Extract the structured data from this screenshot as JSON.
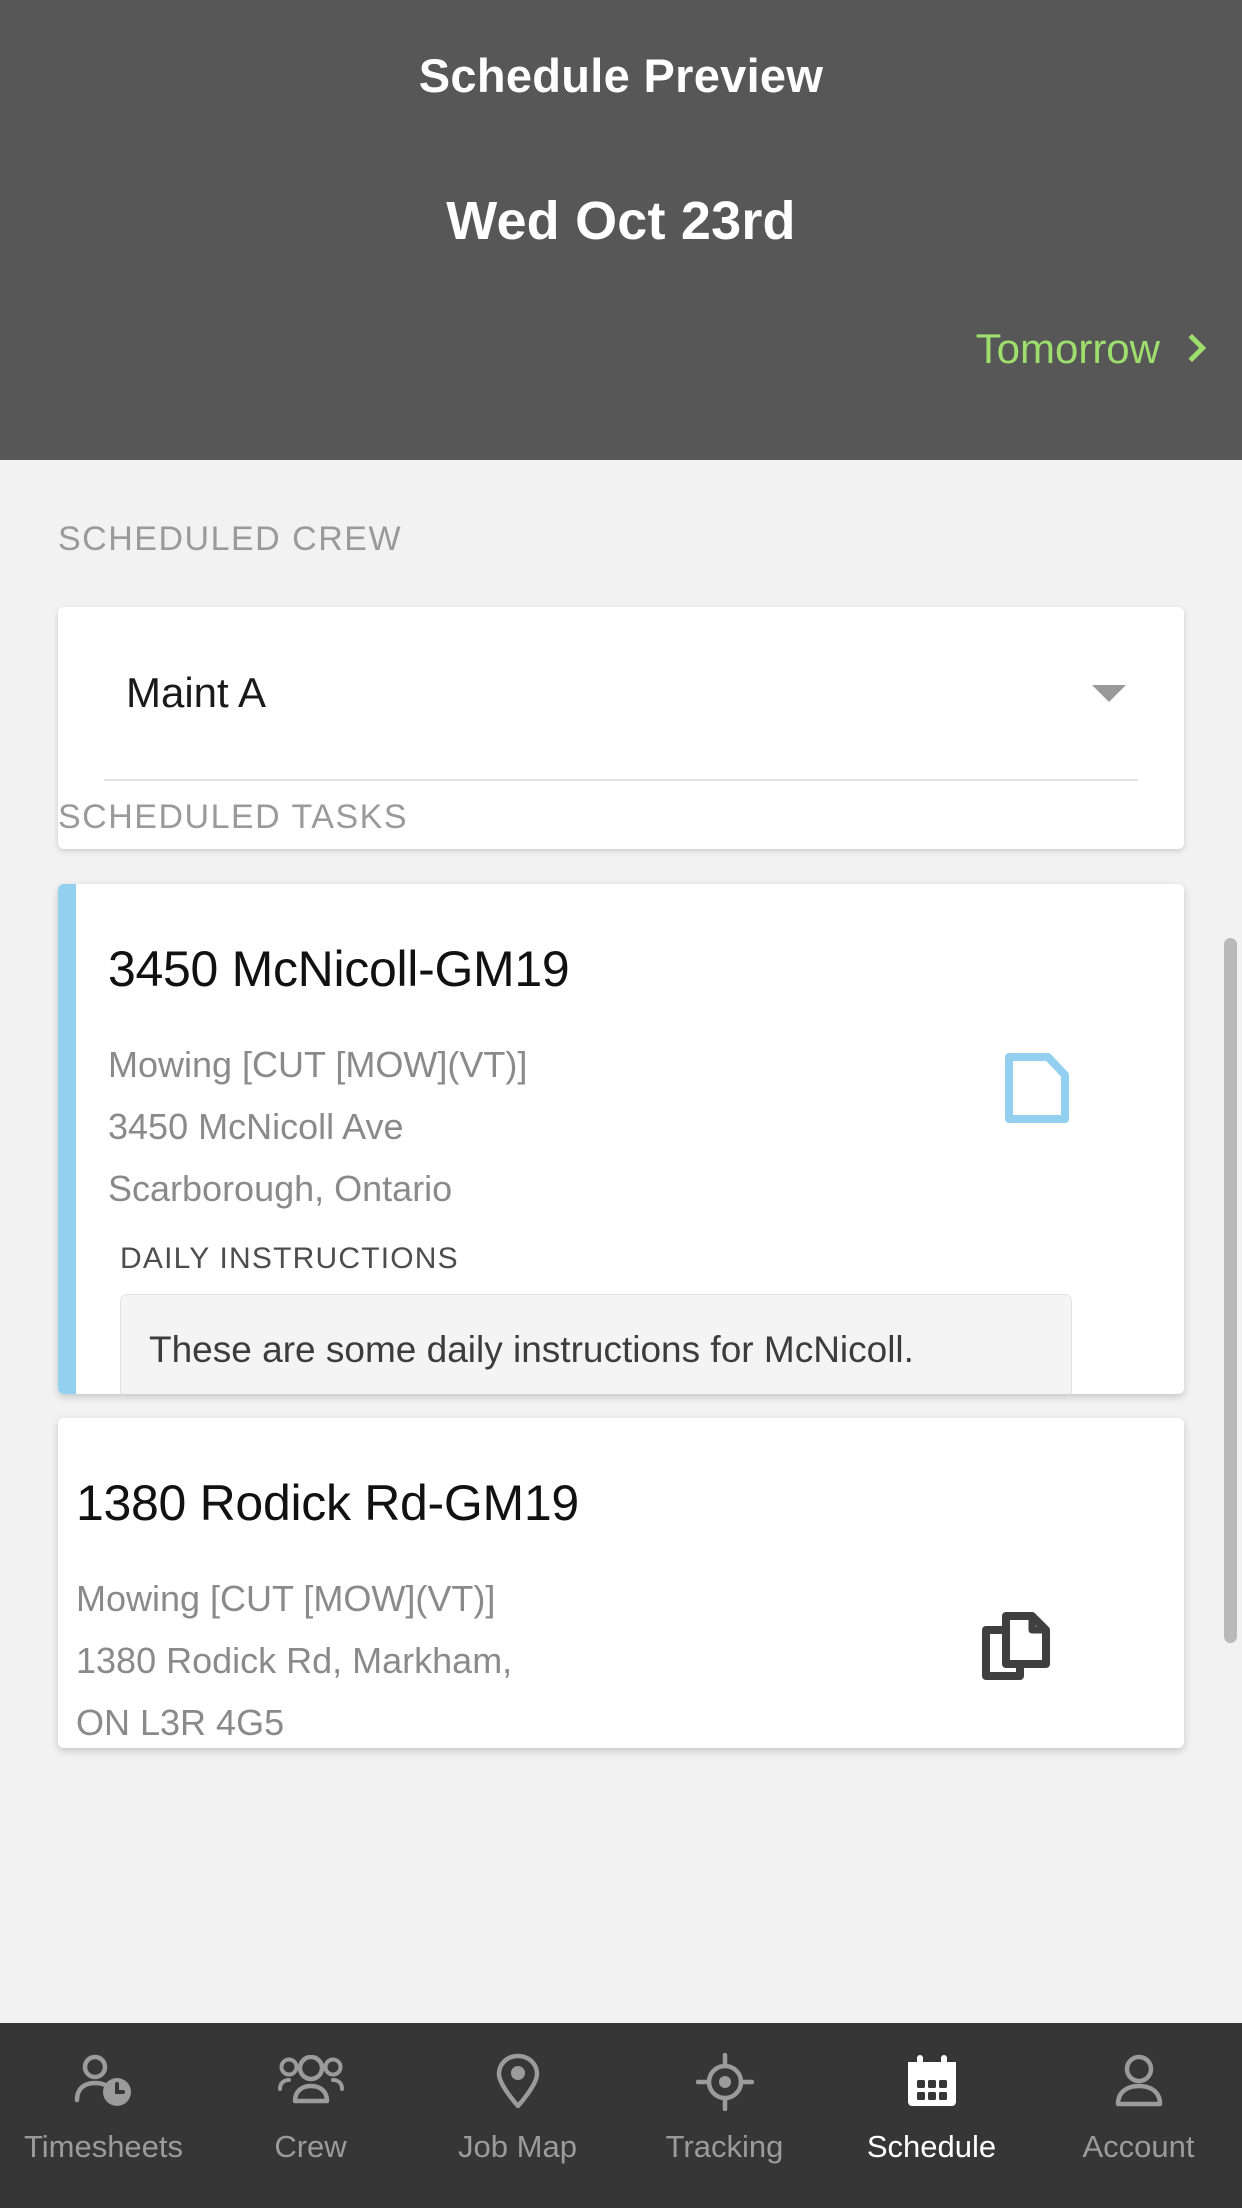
{
  "header": {
    "title": "Schedule Preview",
    "date": "Wed Oct 23rd",
    "next_label": "Tomorrow",
    "next_icon": "chevron-right-icon",
    "background_color": "#575757",
    "accent_color": "#9ede6c"
  },
  "crew_section": {
    "label": "SCHEDULED CREW",
    "selected_crew": "Maint A",
    "dropdown_icon": "caret-down-icon"
  },
  "tasks_section": {
    "label": "SCHEDULED TASKS",
    "accent_color": "#93d0f0",
    "items": [
      {
        "title": "3450 McNicoll-GM19",
        "service": "Mowing [CUT [MOW](VT)]",
        "address_line1": "3450 McNicoll Ave",
        "address_line2": "Scarborough, Ontario",
        "icon": "note-document-icon",
        "icon_color": "#93d0f0",
        "instructions_label": "DAILY INSTRUCTIONS",
        "instructions_text": "These are some daily instructions for McNicoll."
      },
      {
        "title": "1380 Rodick Rd-GM19",
        "service": "Mowing [CUT [MOW](VT)]",
        "address_line1": "1380 Rodick Rd, Markham,",
        "address_line2": "ON L3R 4G5",
        "icon": "copy-documents-icon",
        "icon_color": "#3f3f3f"
      }
    ]
  },
  "tabbar": {
    "background_color": "#363636",
    "active_color": "#ffffff",
    "inactive_color": "#9b9b9b",
    "items": [
      {
        "label": "Timesheets",
        "icon": "person-clock-icon",
        "active": false
      },
      {
        "label": "Crew",
        "icon": "people-group-icon",
        "active": false
      },
      {
        "label": "Job Map",
        "icon": "map-pin-icon",
        "active": false
      },
      {
        "label": "Tracking",
        "icon": "crosshair-target-icon",
        "active": false
      },
      {
        "label": "Schedule",
        "icon": "calendar-icon",
        "active": true
      },
      {
        "label": "Account",
        "icon": "person-icon",
        "active": false
      }
    ]
  }
}
